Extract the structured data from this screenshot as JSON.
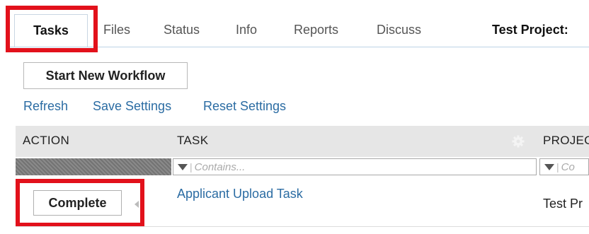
{
  "tabs": {
    "items": [
      "Tasks",
      "Files",
      "Status",
      "Info",
      "Reports",
      "Discuss"
    ],
    "active": "Tasks"
  },
  "project_title": "Test Project:",
  "toolbar": {
    "start_workflow_label": "Start New Workflow"
  },
  "links": {
    "refresh": "Refresh",
    "save_settings": "Save Settings",
    "reset_settings": "Reset Settings"
  },
  "grid": {
    "columns": [
      "ACTION",
      "TASK",
      "PROJEC"
    ],
    "filter_placeholder_task": "Contains...",
    "filter_placeholder_project": "Co",
    "rows": [
      {
        "action_label": "Complete",
        "task": "Applicant Upload Task",
        "project": "Test Pr"
      }
    ]
  },
  "colors": {
    "highlight": "#e2111b",
    "link": "#2b6ca3",
    "header_bg": "#e6e6e6"
  },
  "icons": [
    "gear-icon",
    "filter-icon"
  ]
}
